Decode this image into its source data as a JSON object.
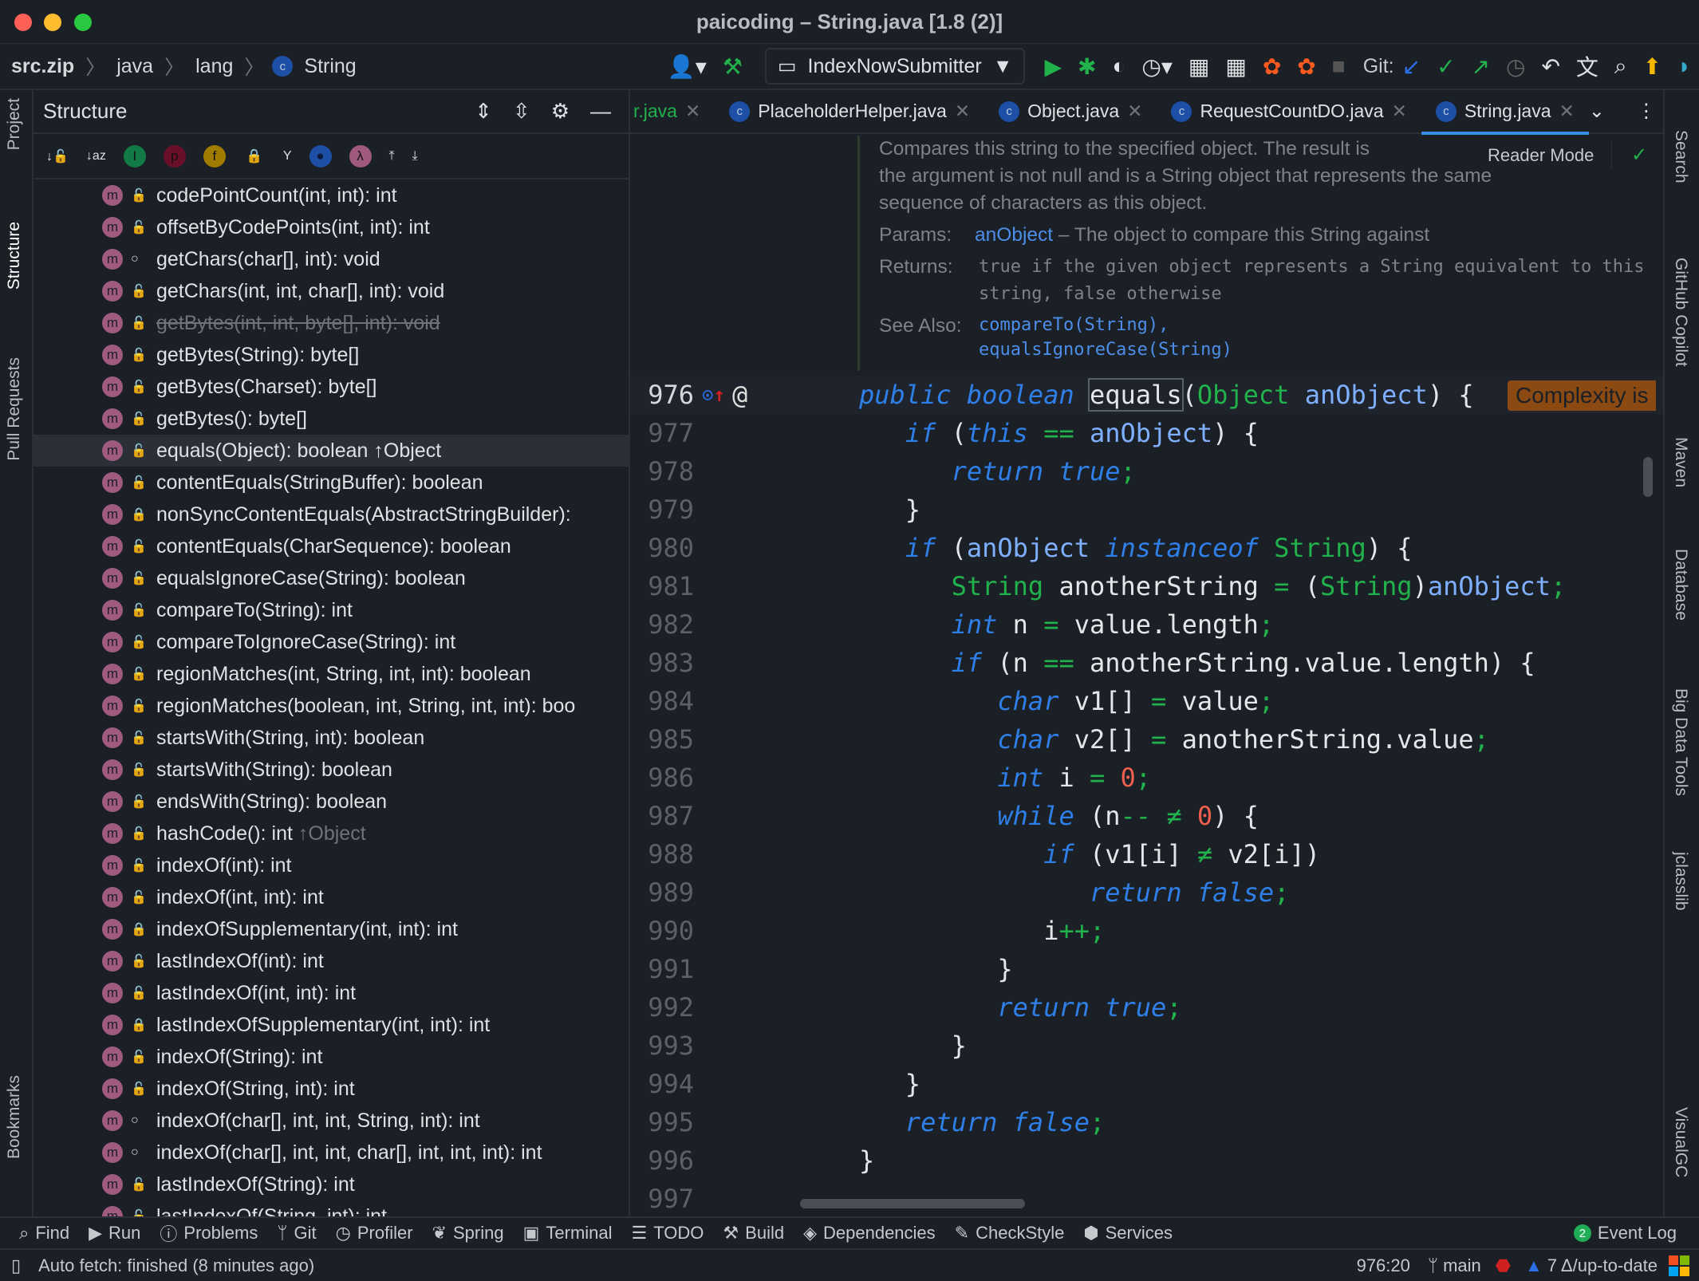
{
  "window": {
    "title": "paicoding – String.java [1.8 (2)]"
  },
  "breadcrumb": [
    "src.zip",
    "java",
    "lang",
    "String"
  ],
  "toolbar": {
    "run_config": "IndexNowSubmitter",
    "git_label": "Git:"
  },
  "left_strip": [
    "Project",
    "Structure",
    "Pull Requests",
    "Bookmarks"
  ],
  "right_strip": [
    "Search",
    "GitHub Copilot",
    "Maven",
    "Database",
    "Big Data Tools",
    "jclasslib",
    "VisualGC"
  ],
  "structure": {
    "title": "Structure",
    "items": [
      {
        "label": "codePointCount(int, int): int",
        "vis": "public"
      },
      {
        "label": "offsetByCodePoints(int, int): int",
        "vis": "public"
      },
      {
        "label": "getChars(char[], int): void",
        "vis": "package"
      },
      {
        "label": "getChars(int, int, char[], int): void",
        "vis": "public"
      },
      {
        "label": "getBytes(int, int, byte[], int): void",
        "vis": "public",
        "deprecated": true
      },
      {
        "label": "getBytes(String): byte[]",
        "vis": "public"
      },
      {
        "label": "getBytes(Charset): byte[]",
        "vis": "public"
      },
      {
        "label": "getBytes(): byte[]",
        "vis": "public"
      },
      {
        "label": "equals(Object): boolean ↑Object",
        "vis": "public",
        "selected": true
      },
      {
        "label": "contentEquals(StringBuffer): boolean",
        "vis": "public"
      },
      {
        "label": "nonSyncContentEquals(AbstractStringBuilder):",
        "vis": "private"
      },
      {
        "label": "contentEquals(CharSequence): boolean",
        "vis": "public"
      },
      {
        "label": "equalsIgnoreCase(String): boolean",
        "vis": "public"
      },
      {
        "label": "compareTo(String): int",
        "vis": "public"
      },
      {
        "label": "compareToIgnoreCase(String): int",
        "vis": "public"
      },
      {
        "label": "regionMatches(int, String, int, int): boolean",
        "vis": "public"
      },
      {
        "label": "regionMatches(boolean, int, String, int, int): boo",
        "vis": "public"
      },
      {
        "label": "startsWith(String, int): boolean",
        "vis": "public"
      },
      {
        "label": "startsWith(String): boolean",
        "vis": "public"
      },
      {
        "label": "endsWith(String): boolean",
        "vis": "public"
      },
      {
        "label": "hashCode(): int",
        "suffix": "↑Object",
        "vis": "public"
      },
      {
        "label": "indexOf(int): int",
        "vis": "public"
      },
      {
        "label": "indexOf(int, int): int",
        "vis": "public"
      },
      {
        "label": "indexOfSupplementary(int, int): int",
        "vis": "private"
      },
      {
        "label": "lastIndexOf(int): int",
        "vis": "public"
      },
      {
        "label": "lastIndexOf(int, int): int",
        "vis": "public"
      },
      {
        "label": "lastIndexOfSupplementary(int, int): int",
        "vis": "private"
      },
      {
        "label": "indexOf(String): int",
        "vis": "public"
      },
      {
        "label": "indexOf(String, int): int",
        "vis": "public"
      },
      {
        "label": "indexOf(char[], int, int, String, int): int",
        "vis": "package"
      },
      {
        "label": "indexOf(char[], int, int, char[], int, int, int): int",
        "vis": "package"
      },
      {
        "label": "lastIndexOf(String): int",
        "vis": "public"
      },
      {
        "label": "lastIndexOf(String, int): int",
        "vis": "public"
      }
    ]
  },
  "tabs": [
    {
      "label": "r.java",
      "color": "#22b24c"
    },
    {
      "label": "PlaceholderHelper.java"
    },
    {
      "label": "Object.java"
    },
    {
      "label": "RequestCountDO.java"
    },
    {
      "label": "String.java",
      "active": true
    }
  ],
  "doc": {
    "reader_mode": "Reader Mode",
    "desc": [
      "Compares this string to the specified object. The result is",
      "the argument is not null and is a String object that represents the same",
      "sequence of characters as this object."
    ],
    "params_label": "Params:",
    "param_name": "anObject",
    "param_desc": " – The object to compare this String against",
    "returns_label": "Returns:",
    "returns": [
      "true if the given object represents a String equivalent to this",
      "string, false otherwise"
    ],
    "see_label": "See Also:",
    "see": [
      "compareTo(String),",
      "equalsIgnoreCase(String)"
    ]
  },
  "code": {
    "complexity": "Complexity is",
    "lines": [
      {
        "n": "976",
        "t": [
          [
            "kw",
            "public boolean "
          ],
          [
            "box",
            "equals"
          ],
          [
            "",
            "("
          ],
          [
            "ty",
            "Object "
          ],
          [
            "pa",
            "anObject"
          ],
          [
            "",
            ") {"
          ]
        ]
      },
      {
        "n": "977",
        "t": [
          [
            "",
            "   "
          ],
          [
            "kw",
            "if "
          ],
          [
            "",
            "("
          ],
          [
            "kw",
            "this "
          ],
          [
            "op",
            "== "
          ],
          [
            "pa",
            "anObject"
          ],
          [
            "",
            ") {"
          ]
        ]
      },
      {
        "n": "978",
        "t": [
          [
            "",
            "      "
          ],
          [
            "kw",
            "return true"
          ],
          [
            "op",
            ";"
          ]
        ]
      },
      {
        "n": "979",
        "t": [
          [
            "",
            "   }"
          ]
        ]
      },
      {
        "n": "980",
        "t": [
          [
            "",
            "   "
          ],
          [
            "kw",
            "if "
          ],
          [
            "",
            "("
          ],
          [
            "pa",
            "anObject "
          ],
          [
            "kw",
            "instanceof "
          ],
          [
            "ty",
            "String"
          ],
          [
            "",
            ") {"
          ]
        ]
      },
      {
        "n": "981",
        "t": [
          [
            "",
            "      "
          ],
          [
            "ty",
            "String "
          ],
          [
            "",
            "anotherString "
          ],
          [
            "op",
            "= "
          ],
          [
            "",
            "("
          ],
          [
            "ty",
            "String"
          ],
          [
            "",
            ")"
          ],
          [
            "pa",
            "anObject"
          ],
          [
            "op",
            ";"
          ]
        ]
      },
      {
        "n": "982",
        "t": [
          [
            "",
            "      "
          ],
          [
            "kw",
            "int "
          ],
          [
            "",
            "n "
          ],
          [
            "op",
            "= "
          ],
          [
            "",
            "value.length"
          ],
          [
            "op",
            ";"
          ]
        ]
      },
      {
        "n": "983",
        "t": [
          [
            "",
            "      "
          ],
          [
            "kw",
            "if "
          ],
          [
            "",
            "(n "
          ],
          [
            "op",
            "== "
          ],
          [
            "",
            "anotherString.value.length) {"
          ]
        ]
      },
      {
        "n": "984",
        "t": [
          [
            "",
            "         "
          ],
          [
            "kw",
            "char "
          ],
          [
            "",
            "v1[] "
          ],
          [
            "op",
            "= "
          ],
          [
            "",
            "value"
          ],
          [
            "op",
            ";"
          ]
        ]
      },
      {
        "n": "985",
        "t": [
          [
            "",
            "         "
          ],
          [
            "kw",
            "char "
          ],
          [
            "",
            "v2[] "
          ],
          [
            "op",
            "= "
          ],
          [
            "",
            "anotherString.value"
          ],
          [
            "op",
            ";"
          ]
        ]
      },
      {
        "n": "986",
        "t": [
          [
            "",
            "         "
          ],
          [
            "kw",
            "int "
          ],
          [
            "",
            "i "
          ],
          [
            "op",
            "= "
          ],
          [
            "nu",
            "0"
          ],
          [
            "op",
            ";"
          ]
        ]
      },
      {
        "n": "987",
        "t": [
          [
            "",
            "         "
          ],
          [
            "kw",
            "while "
          ],
          [
            "",
            "(n"
          ],
          [
            "op",
            "-- ≠ "
          ],
          [
            "nu",
            "0"
          ],
          [
            "",
            ") {"
          ]
        ]
      },
      {
        "n": "988",
        "t": [
          [
            "",
            "            "
          ],
          [
            "kw",
            "if "
          ],
          [
            "",
            "(v1[i] "
          ],
          [
            "op",
            "≠ "
          ],
          [
            "",
            "v2[i])"
          ]
        ]
      },
      {
        "n": "989",
        "t": [
          [
            "",
            "               "
          ],
          [
            "kw",
            "return false"
          ],
          [
            "op",
            ";"
          ]
        ]
      },
      {
        "n": "990",
        "t": [
          [
            "",
            "            i"
          ],
          [
            "op",
            "++;"
          ]
        ]
      },
      {
        "n": "991",
        "t": [
          [
            "",
            "         }"
          ]
        ]
      },
      {
        "n": "992",
        "t": [
          [
            "",
            "         "
          ],
          [
            "kw",
            "return true"
          ],
          [
            "op",
            ";"
          ]
        ]
      },
      {
        "n": "993",
        "t": [
          [
            "",
            "      }"
          ]
        ]
      },
      {
        "n": "994",
        "t": [
          [
            "",
            "   }"
          ]
        ]
      },
      {
        "n": "995",
        "t": [
          [
            "",
            "   "
          ],
          [
            "kw",
            "return false"
          ],
          [
            "op",
            ";"
          ]
        ]
      },
      {
        "n": "996",
        "t": [
          [
            "",
            "}"
          ]
        ]
      },
      {
        "n": "997",
        "t": []
      }
    ]
  },
  "bottom_tools": [
    "Find",
    "Run",
    "Problems",
    "Git",
    "Profiler",
    "Spring",
    "Terminal",
    "TODO",
    "Build",
    "Dependencies",
    "CheckStyle",
    "Services"
  ],
  "event_log": {
    "count": "2",
    "label": "Event Log"
  },
  "status": {
    "message": "Auto fetch: finished (8 minutes ago)",
    "position": "976:20",
    "branch": "main",
    "sync": "7 Δ/up-to-date"
  }
}
